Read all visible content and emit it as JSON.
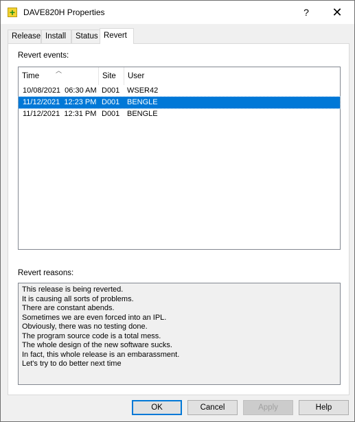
{
  "window": {
    "title": "DAVE820H Properties",
    "help_glyph": "?",
    "close_glyph": "✕",
    "icon": "yellow-plus-icon"
  },
  "tabs": [
    {
      "label": "Release",
      "active": false
    },
    {
      "label": "Install",
      "active": false
    },
    {
      "label": "Status",
      "active": false
    },
    {
      "label": "Revert",
      "active": true
    }
  ],
  "revert_events": {
    "label": "Revert events:",
    "columns": [
      "Time",
      "Site",
      "User"
    ],
    "sort_column": "Time",
    "rows": [
      {
        "time": "10/08/2021  06:30 AM",
        "site": "D001",
        "user": "WSER42",
        "selected": false
      },
      {
        "time": "11/12/2021  12:23 PM",
        "site": "D001",
        "user": "BENGLE",
        "selected": true
      },
      {
        "time": "11/12/2021  12:31 PM",
        "site": "D001",
        "user": "BENGLE",
        "selected": false
      }
    ]
  },
  "revert_reasons": {
    "label": "Revert reasons:",
    "lines": [
      "This release is being reverted.",
      "It is causing all sorts of problems.",
      "There are constant abends.",
      "Sometimes we are even forced into an IPL.",
      "Obviously, there was no testing done.",
      "The program source code is a total mess.",
      "The whole design of the new software sucks.",
      "In fact, this whole release is an embarassment.",
      "Let's try to do better next time"
    ]
  },
  "buttons": {
    "ok": "OK",
    "cancel": "Cancel",
    "apply": "Apply",
    "help": "Help"
  },
  "colors": {
    "selection": "#0078d7",
    "default_button_border": "#0078d7"
  }
}
